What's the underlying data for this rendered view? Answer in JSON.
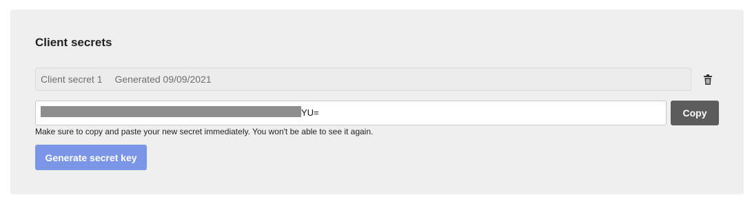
{
  "section": {
    "title": "Client secrets"
  },
  "secret": {
    "name": "Client secret 1",
    "generated": "Generated 09/09/2021",
    "value_visible_suffix": "YU=",
    "value_masked": true
  },
  "actions": {
    "copy_label": "Copy",
    "generate_label": "Generate secret key",
    "delete_icon": "trash-icon"
  },
  "notice": "Make sure to copy and paste your new secret immediately. You won't be able to see it again.",
  "colors": {
    "panel_bg": "#efefef",
    "copy_button": "#5c5c5c",
    "generate_button": "#7b96e6",
    "mask": "#8e8e8e"
  }
}
